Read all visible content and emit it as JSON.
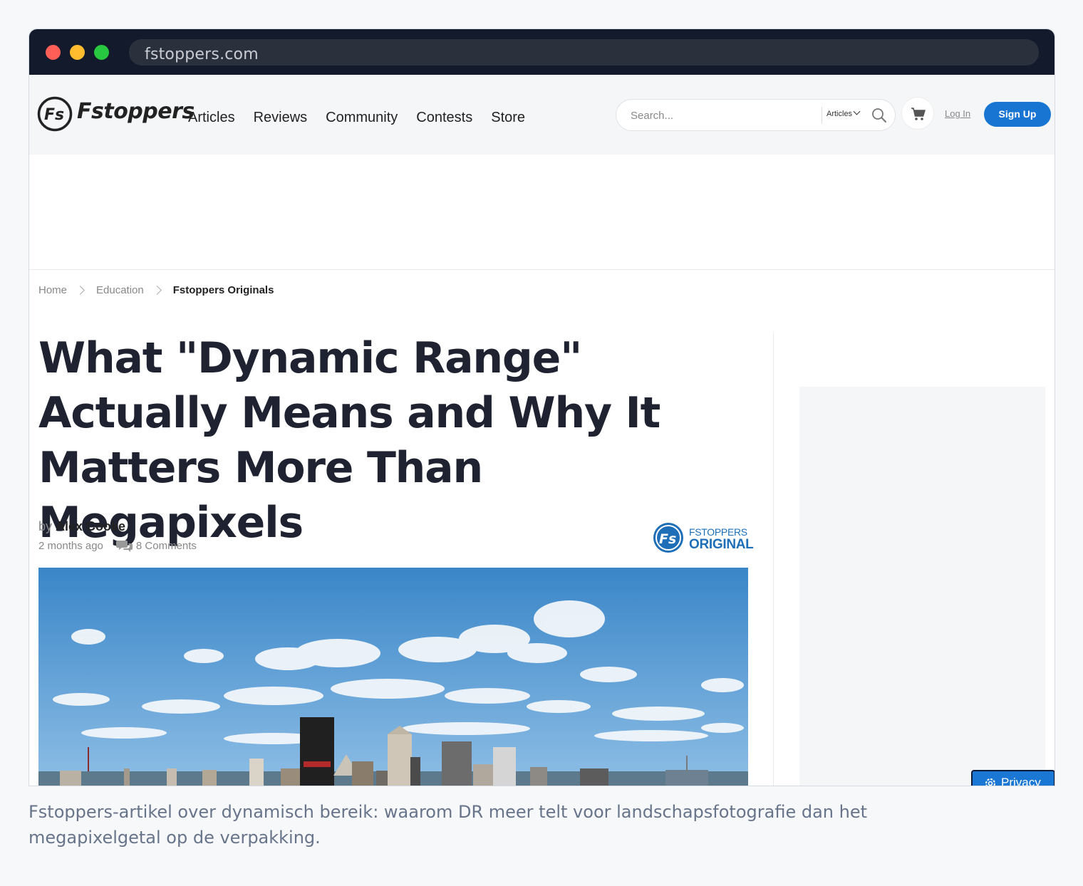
{
  "browser": {
    "url": "fstoppers.com"
  },
  "header": {
    "logo_text": "Fstoppers",
    "nav": [
      "Articles",
      "Reviews",
      "Community",
      "Contests",
      "Store"
    ],
    "search_placeholder": "Search...",
    "search_filter": "Articles",
    "login_label": "Log In",
    "signup_label": "Sign Up"
  },
  "breadcrumb": [
    "Home",
    "Education",
    "Fstoppers Originals"
  ],
  "article": {
    "title": "What \"Dynamic Range\" Actually Means and Why It Matters More Than Megapixels",
    "by_label": "by",
    "author": "Alex Cooke",
    "posted": "2 months ago",
    "comments": "8 Comments",
    "badge_top": "FSTOPPERS",
    "badge_bottom": "ORIGINAL"
  },
  "privacy_label": "Privacy",
  "caption": "Fstoppers-artikel over dynamisch bereik: waarom DR meer telt voor landschapsfotografie dan het megapixelgetal op de verpakking.",
  "colors": {
    "accent": "#1875d2",
    "titlebar": "#121a2b",
    "heading": "#1f2230",
    "badge": "#1e6fb8"
  },
  "icons": [
    "search-icon",
    "chevron-down-icon",
    "cart-icon",
    "comments-icon",
    "gear-icon",
    "chevron-right-icon"
  ]
}
